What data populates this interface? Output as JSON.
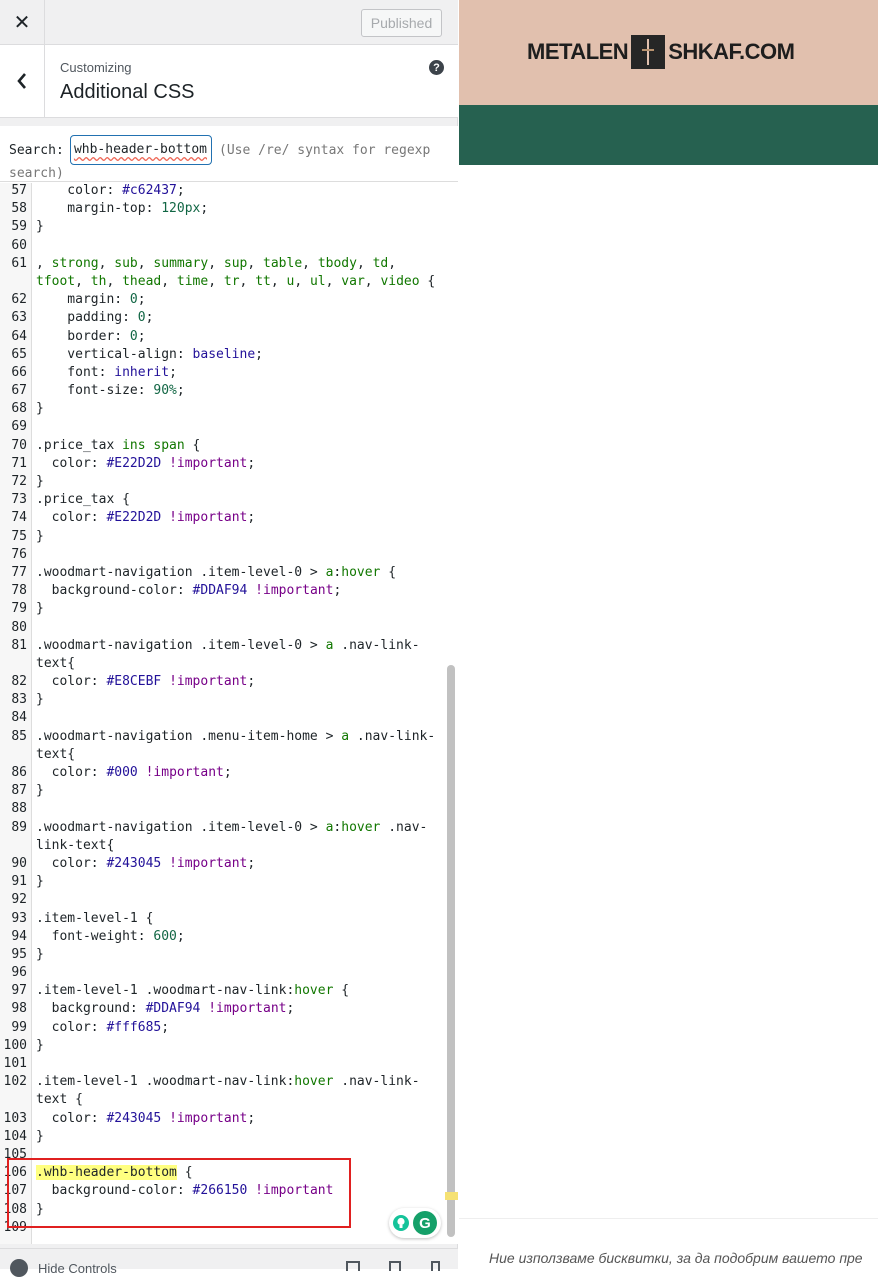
{
  "header": {
    "publish_label": "Published"
  },
  "section": {
    "eyebrow": "Customizing",
    "title": "Additional CSS",
    "help": "?"
  },
  "search": {
    "label": "Search:",
    "value": "whb-header-bottom",
    "hint": "(Use /re/ syntax for regexp",
    "hint_cont": "search)"
  },
  "code_lines": [
    {
      "n": "57",
      "t": [
        [
          "p",
          "    color: "
        ],
        [
          "h",
          "#c62437"
        ],
        [
          "p",
          ";"
        ]
      ]
    },
    {
      "n": "58",
      "t": [
        [
          "p",
          "    margin-top: "
        ],
        [
          "nm",
          "120px"
        ],
        [
          "p",
          ";"
        ]
      ]
    },
    {
      "n": "59",
      "t": [
        [
          "p",
          "}"
        ]
      ]
    },
    {
      "n": "60",
      "t": []
    },
    {
      "n": "61",
      "t": [
        [
          "p",
          ", "
        ],
        [
          "g",
          "strong"
        ],
        [
          "p",
          ", "
        ],
        [
          "g",
          "sub"
        ],
        [
          "p",
          ", "
        ],
        [
          "g",
          "summary"
        ],
        [
          "p",
          ", "
        ],
        [
          "g",
          "sup"
        ],
        [
          "p",
          ", "
        ],
        [
          "g",
          "table"
        ],
        [
          "p",
          ", "
        ],
        [
          "g",
          "tbody"
        ],
        [
          "p",
          ", "
        ],
        [
          "g",
          "td"
        ],
        [
          "p",
          ","
        ]
      ]
    },
    {
      "n": "",
      "t": [
        [
          "g",
          "tfoot"
        ],
        [
          "p",
          ", "
        ],
        [
          "g",
          "th"
        ],
        [
          "p",
          ", "
        ],
        [
          "g",
          "thead"
        ],
        [
          "p",
          ", "
        ],
        [
          "g",
          "time"
        ],
        [
          "p",
          ", "
        ],
        [
          "g",
          "tr"
        ],
        [
          "p",
          ", "
        ],
        [
          "g",
          "tt"
        ],
        [
          "p",
          ", "
        ],
        [
          "g",
          "u"
        ],
        [
          "p",
          ", "
        ],
        [
          "g",
          "ul"
        ],
        [
          "p",
          ", "
        ],
        [
          "g",
          "var"
        ],
        [
          "p",
          ", "
        ],
        [
          "g",
          "video"
        ],
        [
          "p",
          " {"
        ]
      ]
    },
    {
      "n": "62",
      "t": [
        [
          "p",
          "    margin: "
        ],
        [
          "nm",
          "0"
        ],
        [
          "p",
          ";"
        ]
      ]
    },
    {
      "n": "63",
      "t": [
        [
          "p",
          "    padding: "
        ],
        [
          "nm",
          "0"
        ],
        [
          "p",
          ";"
        ]
      ]
    },
    {
      "n": "64",
      "t": [
        [
          "p",
          "    border: "
        ],
        [
          "nm",
          "0"
        ],
        [
          "p",
          ";"
        ]
      ]
    },
    {
      "n": "65",
      "t": [
        [
          "p",
          "    vertical-align: "
        ],
        [
          "h",
          "baseline"
        ],
        [
          "p",
          ";"
        ]
      ]
    },
    {
      "n": "66",
      "t": [
        [
          "p",
          "    font: "
        ],
        [
          "h",
          "inherit"
        ],
        [
          "p",
          ";"
        ]
      ]
    },
    {
      "n": "67",
      "t": [
        [
          "p",
          "    font-size: "
        ],
        [
          "nm",
          "90%"
        ],
        [
          "p",
          ";"
        ]
      ]
    },
    {
      "n": "68",
      "t": [
        [
          "p",
          "}"
        ]
      ]
    },
    {
      "n": "69",
      "t": []
    },
    {
      "n": "70",
      "t": [
        [
          "p",
          ".price_tax "
        ],
        [
          "g",
          "ins"
        ],
        [
          "p",
          " "
        ],
        [
          "g",
          "span"
        ],
        [
          "p",
          " {"
        ]
      ]
    },
    {
      "n": "71",
      "t": [
        [
          "p",
          "  color: "
        ],
        [
          "h",
          "#E22D2D"
        ],
        [
          "p",
          " "
        ],
        [
          "k",
          "!important"
        ],
        [
          "p",
          ";"
        ]
      ]
    },
    {
      "n": "72",
      "t": [
        [
          "p",
          "}"
        ]
      ]
    },
    {
      "n": "73",
      "t": [
        [
          "p",
          ".price_tax {"
        ]
      ]
    },
    {
      "n": "74",
      "t": [
        [
          "p",
          "  color: "
        ],
        [
          "h",
          "#E22D2D"
        ],
        [
          "p",
          " "
        ],
        [
          "k",
          "!important"
        ],
        [
          "p",
          ";"
        ]
      ]
    },
    {
      "n": "75",
      "t": [
        [
          "p",
          "}"
        ]
      ]
    },
    {
      "n": "76",
      "t": []
    },
    {
      "n": "77",
      "t": [
        [
          "p",
          ".woodmart-navigation .item-level-0 > "
        ],
        [
          "g",
          "a"
        ],
        [
          "p",
          ":"
        ],
        [
          "g",
          "hover"
        ],
        [
          "p",
          " {"
        ]
      ]
    },
    {
      "n": "78",
      "t": [
        [
          "p",
          "  background-color: "
        ],
        [
          "h",
          "#DDAF94"
        ],
        [
          "p",
          " "
        ],
        [
          "k",
          "!important"
        ],
        [
          "p",
          ";"
        ]
      ]
    },
    {
      "n": "79",
      "t": [
        [
          "p",
          "}"
        ]
      ]
    },
    {
      "n": "80",
      "t": []
    },
    {
      "n": "81",
      "t": [
        [
          "p",
          ".woodmart-navigation .item-level-0 > "
        ],
        [
          "g",
          "a"
        ],
        [
          "p",
          " .nav-link-"
        ]
      ]
    },
    {
      "n": "",
      "t": [
        [
          "p",
          "text{"
        ]
      ]
    },
    {
      "n": "82",
      "t": [
        [
          "p",
          "  color: "
        ],
        [
          "h",
          "#E8CEBF"
        ],
        [
          "p",
          " "
        ],
        [
          "k",
          "!important"
        ],
        [
          "p",
          ";"
        ]
      ]
    },
    {
      "n": "83",
      "t": [
        [
          "p",
          "}"
        ]
      ]
    },
    {
      "n": "84",
      "t": []
    },
    {
      "n": "85",
      "t": [
        [
          "p",
          ".woodmart-navigation .menu-item-home > "
        ],
        [
          "g",
          "a"
        ],
        [
          "p",
          " .nav-link-"
        ]
      ]
    },
    {
      "n": "",
      "t": [
        [
          "p",
          "text{"
        ]
      ]
    },
    {
      "n": "86",
      "t": [
        [
          "p",
          "  color: "
        ],
        [
          "h",
          "#000"
        ],
        [
          "p",
          " "
        ],
        [
          "k",
          "!important"
        ],
        [
          "p",
          ";"
        ]
      ]
    },
    {
      "n": "87",
      "t": [
        [
          "p",
          "}"
        ]
      ]
    },
    {
      "n": "88",
      "t": []
    },
    {
      "n": "89",
      "t": [
        [
          "p",
          ".woodmart-navigation .item-level-0 > "
        ],
        [
          "g",
          "a"
        ],
        [
          "p",
          ":"
        ],
        [
          "g",
          "hover"
        ],
        [
          "p",
          " .nav-"
        ]
      ]
    },
    {
      "n": "",
      "t": [
        [
          "p",
          "link-text{"
        ]
      ]
    },
    {
      "n": "90",
      "t": [
        [
          "p",
          "  color: "
        ],
        [
          "h",
          "#243045"
        ],
        [
          "p",
          " "
        ],
        [
          "k",
          "!important"
        ],
        [
          "p",
          ";"
        ]
      ]
    },
    {
      "n": "91",
      "t": [
        [
          "p",
          "}"
        ]
      ]
    },
    {
      "n": "92",
      "t": []
    },
    {
      "n": "93",
      "t": [
        [
          "p",
          ".item-level-1 {"
        ]
      ]
    },
    {
      "n": "94",
      "t": [
        [
          "p",
          "  font-weight: "
        ],
        [
          "nm",
          "600"
        ],
        [
          "p",
          ";"
        ]
      ]
    },
    {
      "n": "95",
      "t": [
        [
          "p",
          "}"
        ]
      ]
    },
    {
      "n": "96",
      "t": []
    },
    {
      "n": "97",
      "t": [
        [
          "p",
          ".item-level-1 .woodmart-nav-link:"
        ],
        [
          "g",
          "hover"
        ],
        [
          "p",
          " {"
        ]
      ]
    },
    {
      "n": "98",
      "t": [
        [
          "p",
          "  background: "
        ],
        [
          "h",
          "#DDAF94"
        ],
        [
          "p",
          " "
        ],
        [
          "k",
          "!important"
        ],
        [
          "p",
          ";"
        ]
      ]
    },
    {
      "n": "99",
      "t": [
        [
          "p",
          "  color: "
        ],
        [
          "h",
          "#fff685"
        ],
        [
          "p",
          ";"
        ]
      ]
    },
    {
      "n": "100",
      "t": [
        [
          "p",
          "}"
        ]
      ]
    },
    {
      "n": "101",
      "t": []
    },
    {
      "n": "102",
      "t": [
        [
          "p",
          ".item-level-1 .woodmart-nav-link:"
        ],
        [
          "g",
          "hover"
        ],
        [
          "p",
          " .nav-link-"
        ]
      ]
    },
    {
      "n": "",
      "t": [
        [
          "p",
          "text {"
        ]
      ]
    },
    {
      "n": "103",
      "t": [
        [
          "p",
          "  color: "
        ],
        [
          "h",
          "#243045"
        ],
        [
          "p",
          " "
        ],
        [
          "k",
          "!important"
        ],
        [
          "p",
          ";"
        ]
      ]
    },
    {
      "n": "104",
      "t": [
        [
          "p",
          "}"
        ]
      ]
    },
    {
      "n": "105",
      "t": []
    },
    {
      "n": "106",
      "t": [
        [
          "hl",
          ".whb-header-bottom"
        ],
        [
          "p",
          " {"
        ]
      ]
    },
    {
      "n": "107",
      "t": [
        [
          "p",
          "  background-color: "
        ],
        [
          "h",
          "#266150"
        ],
        [
          "p",
          " "
        ],
        [
          "k",
          "!important"
        ]
      ]
    },
    {
      "n": "108",
      "t": [
        [
          "p",
          "}"
        ]
      ]
    },
    {
      "n": "109",
      "t": []
    }
  ],
  "footer": {
    "hide_label": "Hide Controls"
  },
  "preview": {
    "logo_left": "METALEN",
    "logo_right": "SHKAF.COM",
    "cookie_text": "Ние използваме бисквитки, за да подобрим вашето пре",
    "colors": {
      "top": "#e1c0ae",
      "bar": "#266150"
    }
  },
  "icons": {
    "close": "close-icon",
    "back": "chevron-left-icon",
    "help": "help-icon",
    "grammarly": "grammarly-icon"
  }
}
